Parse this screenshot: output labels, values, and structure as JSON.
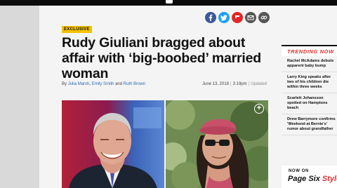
{
  "share": {
    "buttons": [
      {
        "name": "facebook-icon",
        "color": "#3b5998"
      },
      {
        "name": "twitter-icon",
        "color": "#1da1f2"
      },
      {
        "name": "flipboard-icon",
        "color": "#e12828"
      },
      {
        "name": "email-icon",
        "color": "#555555"
      },
      {
        "name": "link-icon",
        "color": "#555555"
      }
    ]
  },
  "article": {
    "tag": "EXCLUSIVE",
    "headline": "Rudy Giuliani bragged about affair with ‘big-boobed’ married woman",
    "byline_prefix": "By",
    "authors": [
      "Julia Marsh",
      "Emily Smith",
      "Ruth Brown"
    ],
    "byline_joiners": [
      ",",
      "and"
    ],
    "date": "June 13, 2018",
    "time": "3:19pm",
    "separator": "|",
    "updated_label": "Updated"
  },
  "sidebar": {
    "heading": "TRENDING NOW",
    "items": [
      "Rachel McAdams debuts apparent baby bump",
      "Larry King speaks after two of his children die within three weeks",
      "Scarlett Johansson spotted on Hamptons beach",
      "Drew Barrymore confirms 'Weekend at Bernie's' rumor about grandfather"
    ]
  },
  "promo": {
    "small": "NOW ON",
    "brand_main": "Page Six",
    "brand_accent": "Style"
  },
  "colors": {
    "accent_red": "#e0302d",
    "tag_yellow": "#f2c200",
    "author_blue": "#2a6ab7"
  }
}
